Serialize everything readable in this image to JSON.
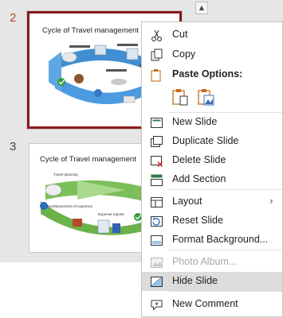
{
  "slides": [
    {
      "number": "2",
      "title": "Cycle of Travel management"
    },
    {
      "number": "3",
      "title": "Cycle of Travel management"
    }
  ],
  "thumbnail_labels": {
    "travel_planning": "Travel planning",
    "reimbursement": "Reimbursement of expenses",
    "expense_reports": "Expense reports"
  },
  "context_menu": {
    "cut": "Cut",
    "copy": "Copy",
    "paste_options": "Paste Options:",
    "new_slide": "New Slide",
    "duplicate_slide": "Duplicate Slide",
    "delete_slide": "Delete Slide",
    "add_section": "Add Section",
    "layout": "Layout",
    "reset_slide": "Reset Slide",
    "format_background": "Format Background...",
    "photo_album": "Photo Album...",
    "hide_slide": "Hide Slide",
    "new_comment": "New Comment"
  },
  "colors": {
    "selected_border": "#8a1b1b",
    "accent_orange": "#d07b1e",
    "highlight": "#dcdcdc"
  }
}
